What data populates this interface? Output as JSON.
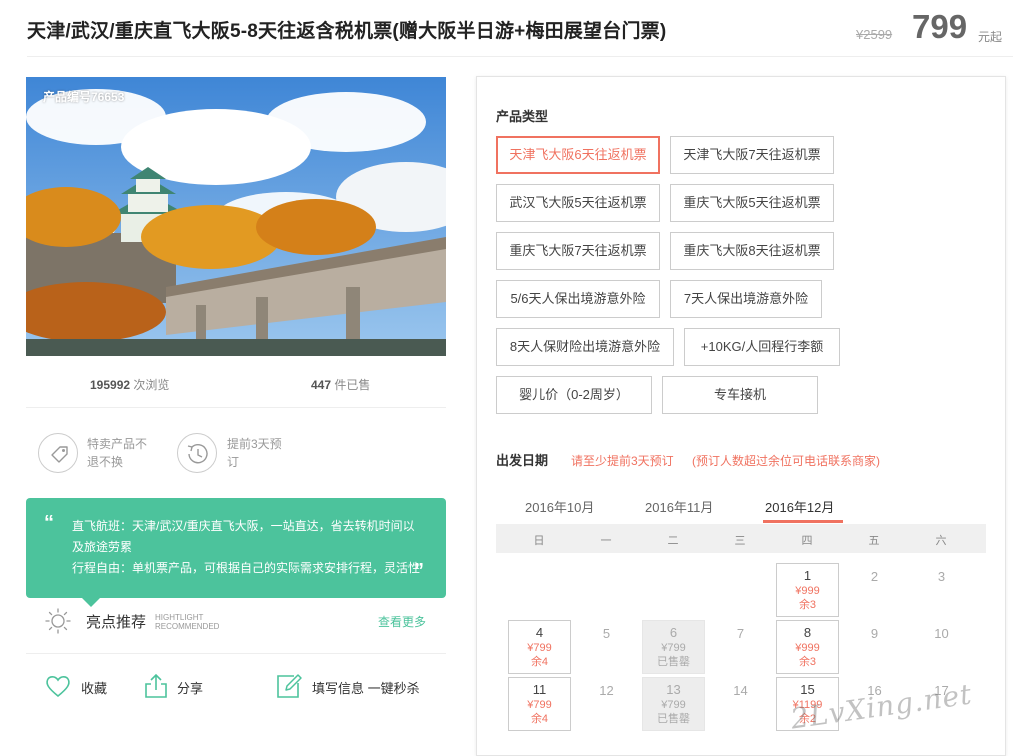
{
  "header": {
    "title": "天津/武汉/重庆直飞大阪5-8天往返含税机票(赠大阪半日游+梅田展望台门票)",
    "original_price": "¥2599",
    "price": "799",
    "price_unit": "元起"
  },
  "gallery": {
    "product_no": "产品编号76653"
  },
  "stats": {
    "views_count": "195992",
    "views_label": "次浏览",
    "sold_count": "447",
    "sold_label": "件已售"
  },
  "notes": [
    {
      "text": "特卖产品不退不换",
      "icon": "price-tag-icon"
    },
    {
      "text": "提前3天预订",
      "icon": "clock-history-icon"
    }
  ],
  "highlight_quote": {
    "line1": "直飞航班：天津/武汉/重庆直飞大阪，一站直达，省去转机时间以及旅途劳累",
    "line2": "行程自由：单机票产品，可根据自己的实际需求安排行程，灵活性"
  },
  "highlights": {
    "title": "亮点推荐",
    "en_line1": "HIGHTLIGHT",
    "en_line2": "RECOMMENDED",
    "more": "查看更多"
  },
  "actions": {
    "favorite": "收藏",
    "share": "分享",
    "fill_info": "填写信息 一键秒杀"
  },
  "product_types": {
    "label": "产品类型",
    "options": [
      "天津飞大阪6天往返机票",
      "天津飞大阪7天往返机票",
      "武汉飞大阪5天往返机票",
      "重庆飞大阪5天往返机票",
      "重庆飞大阪7天往返机票",
      "重庆飞大阪8天往返机票",
      "5/6天人保出境游意外险",
      "7天人保出境游意外险",
      "8天人保财险出境游意外险",
      "+10KG/人回程行李额",
      "婴儿价（0-2周岁）",
      "专车接机"
    ],
    "selected": "天津飞大阪6天往返机票"
  },
  "departure": {
    "label": "出发日期",
    "note1": "请至少提前3天预订",
    "note2": "(预订人数超过余位可电话联系商家)",
    "months": [
      "2016年10月",
      "2016年11月",
      "2016年12月"
    ],
    "active_month": "2016年12月",
    "weekdays": [
      "日",
      "一",
      "二",
      "三",
      "四",
      "五",
      "六"
    ]
  },
  "calendar": {
    "d1": {
      "day": "1",
      "price": "¥999",
      "remain": "余3"
    },
    "d2": {
      "day": "2"
    },
    "d3": {
      "day": "3"
    },
    "d4": {
      "day": "4",
      "price": "¥799",
      "remain": "余4"
    },
    "d5": {
      "day": "5"
    },
    "d6": {
      "day": "6",
      "price": "¥799",
      "remain": "已售罄"
    },
    "d7": {
      "day": "7"
    },
    "d8": {
      "day": "8",
      "price": "¥999",
      "remain": "余3"
    },
    "d9": {
      "day": "9"
    },
    "d10": {
      "day": "10"
    },
    "d11": {
      "day": "11",
      "price": "¥799",
      "remain": "余4"
    },
    "d12": {
      "day": "12"
    },
    "d13": {
      "day": "13",
      "price": "¥799",
      "remain": "已售罄"
    },
    "d14": {
      "day": "14"
    },
    "d15": {
      "day": "15",
      "price": "¥1199",
      "remain": "余2"
    },
    "d16": {
      "day": "16"
    },
    "d17": {
      "day": "17"
    }
  },
  "watermark": "2LvXing.net",
  "colors": {
    "accent": "#f07260",
    "green": "#4cc39c"
  }
}
